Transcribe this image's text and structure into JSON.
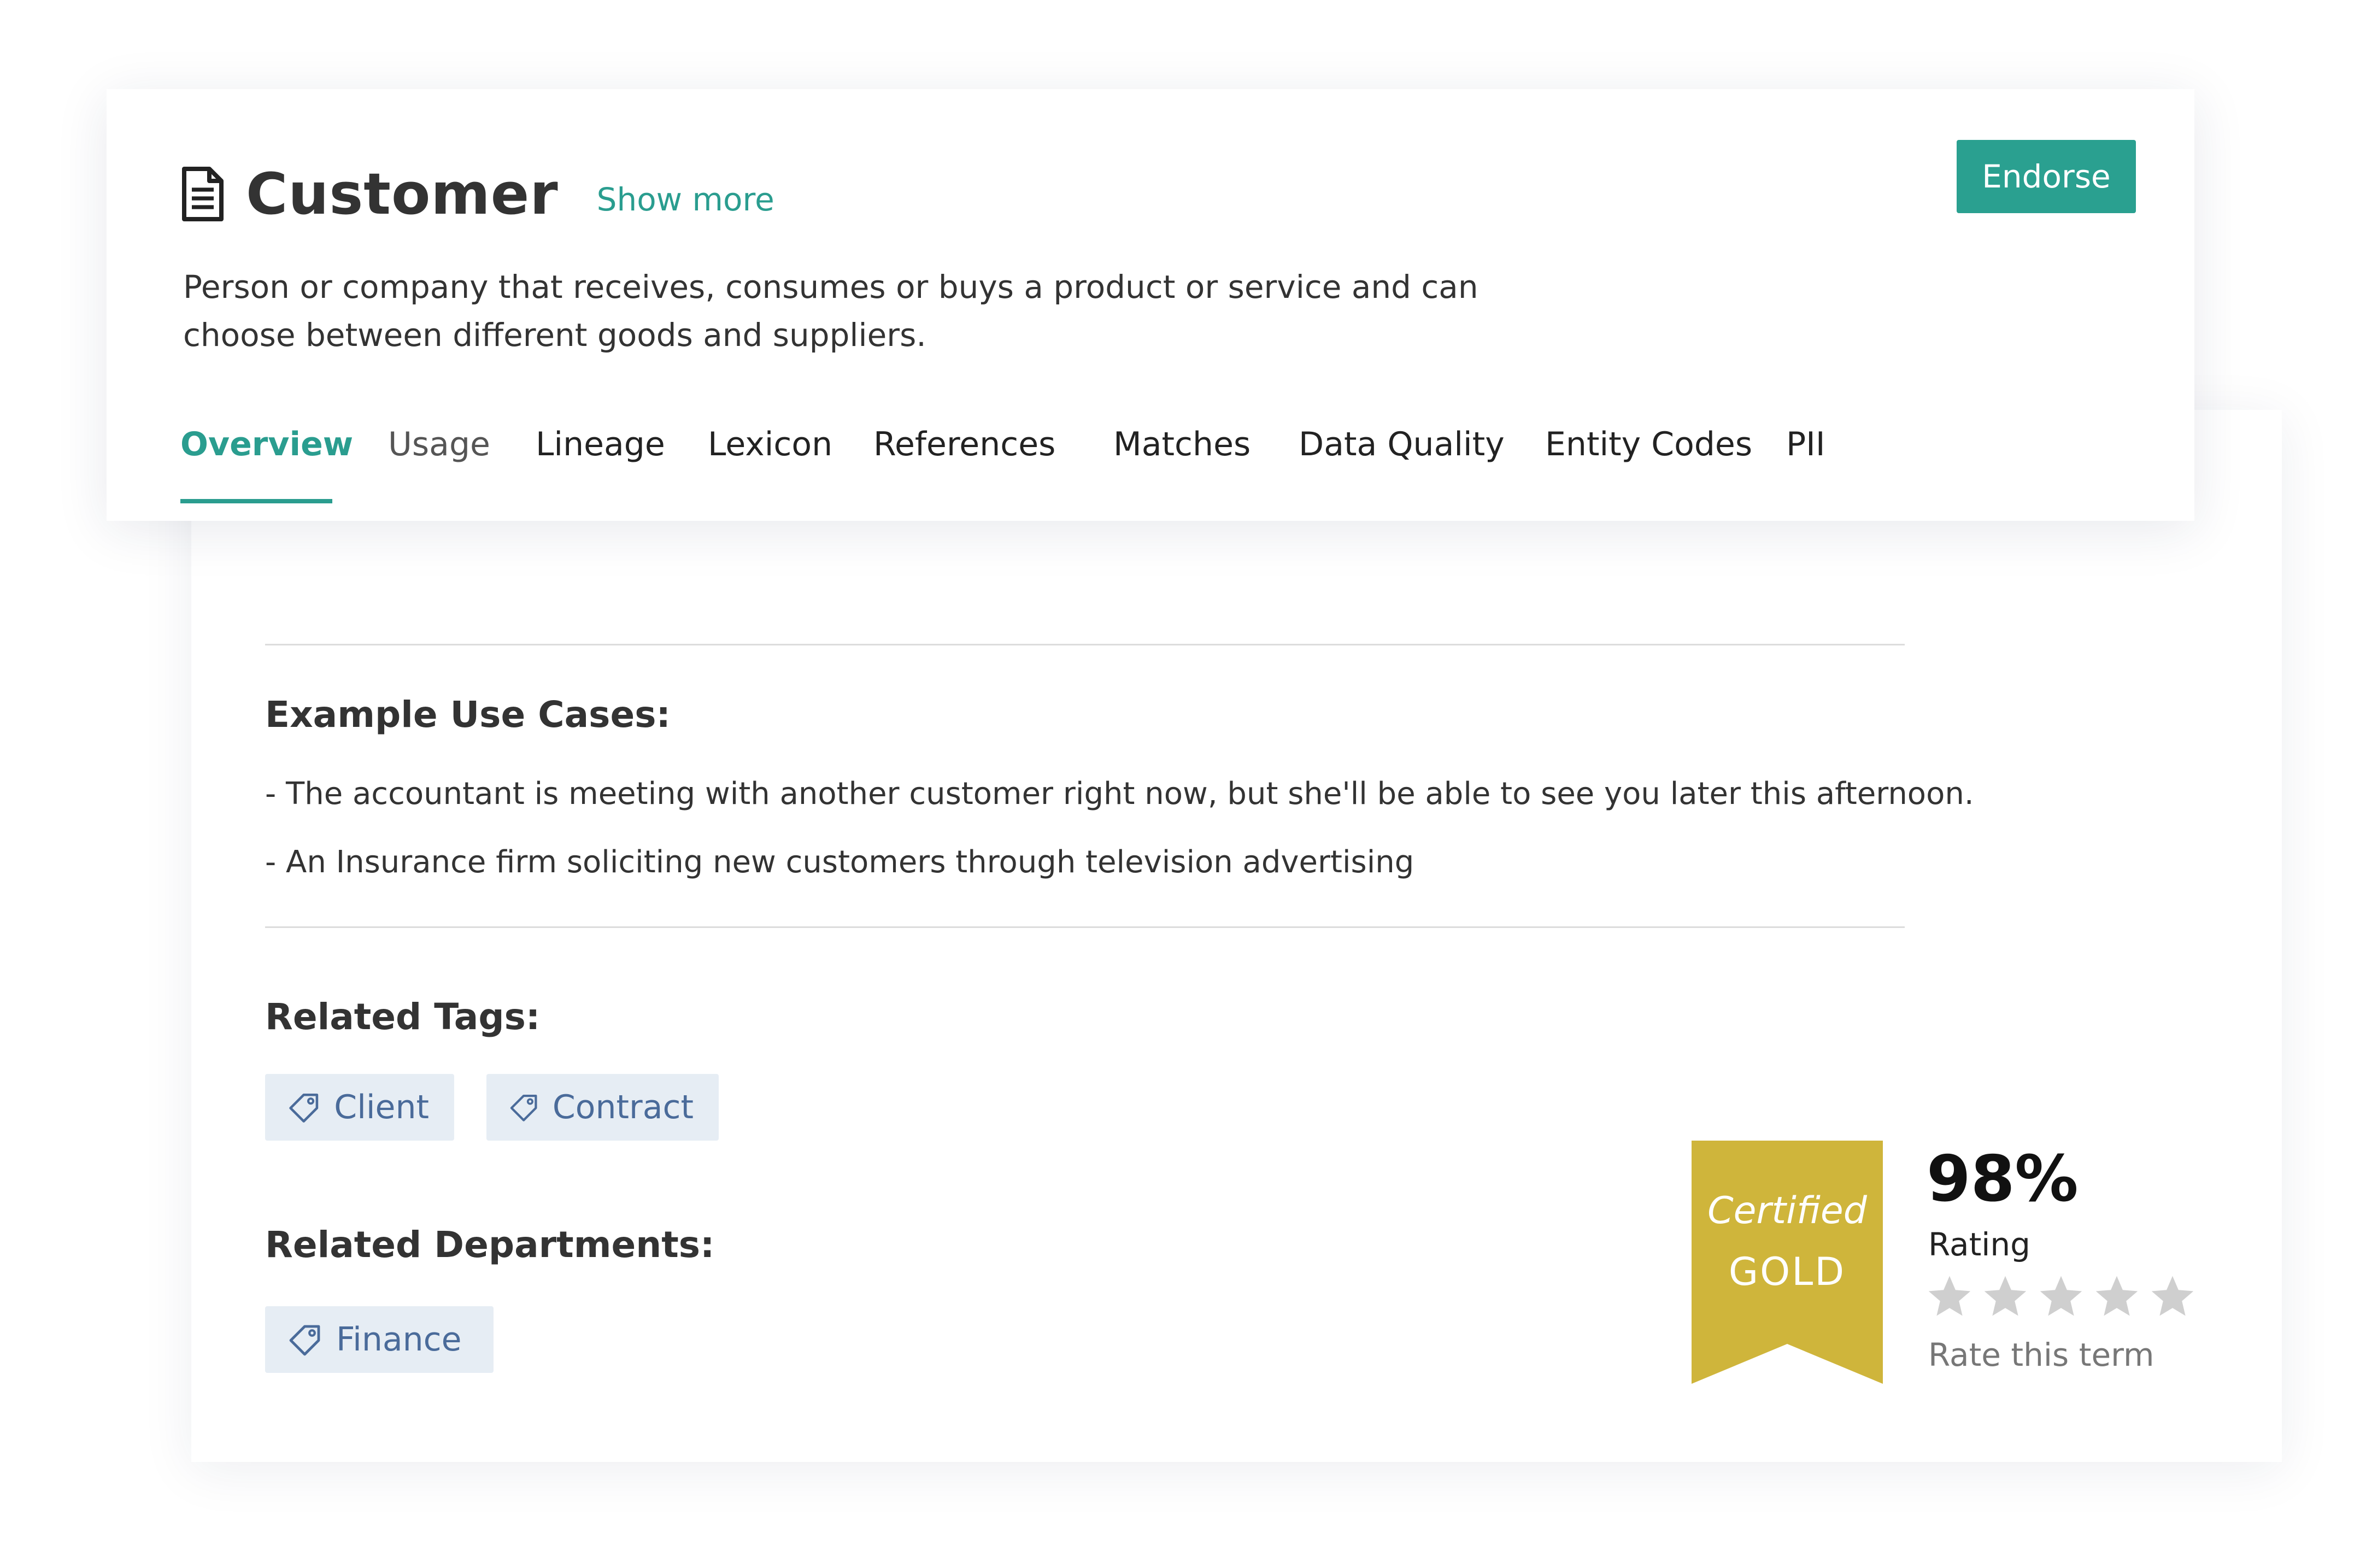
{
  "term": {
    "title": "Customer",
    "show_more_label": "Show more",
    "description": "Person or company that receives, consumes or buys a product or service and can choose between different goods and suppliers.",
    "endorse_label": "Endorse"
  },
  "tabs": [
    {
      "label": "Overview",
      "active": true
    },
    {
      "label": "Usage",
      "active": false
    },
    {
      "label": "Lineage",
      "active": false
    },
    {
      "label": "Lexicon",
      "active": false
    },
    {
      "label": "References",
      "active": false
    },
    {
      "label": "Matches",
      "active": false
    },
    {
      "label": "Data Quality",
      "active": false
    },
    {
      "label": "Entity Codes",
      "active": false
    },
    {
      "label": "PII",
      "active": false
    }
  ],
  "overview": {
    "use_cases_heading": "Example Use Cases:",
    "use_cases": [
      "- The accountant is meeting with another customer right now, but she'll be able to see you later this afternoon.",
      "- An Insurance firm soliciting new customers through television advertising"
    ],
    "related_tags_heading": "Related Tags:",
    "related_tags": [
      {
        "label": "Client",
        "icon": "tag-icon"
      },
      {
        "label": "Contract",
        "icon": "tag-icon"
      }
    ],
    "related_departments_heading": "Related Departments:",
    "related_departments": [
      {
        "label": "Finance",
        "icon": "tag-icon"
      }
    ]
  },
  "certification": {
    "line1": "Certified",
    "line2": "GOLD",
    "color": "#cfb53b"
  },
  "rating": {
    "value": "98%",
    "label": "Rating",
    "stars_total": 5,
    "stars_filled": 0,
    "rate_label": "Rate this term"
  },
  "colors": {
    "accent": "#2a9d8f",
    "button": "#2aa090",
    "tag_bg": "#e6edf4",
    "tag_text": "#4a6b9a",
    "star_empty": "#cfcfcf"
  },
  "icons": {
    "title_icon": "document-icon",
    "tag_icon": "tag-icon",
    "star_icon": "star-icon"
  }
}
